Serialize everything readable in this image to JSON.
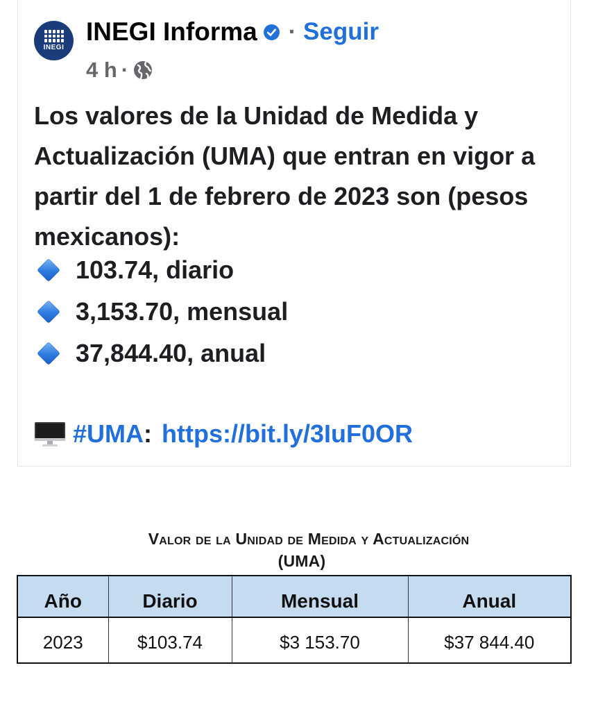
{
  "post": {
    "page_name": "INEGI Informa",
    "separator": "·",
    "follow_label": "Seguir",
    "time": "4 h",
    "meta_separator": "·",
    "avatar_text": "INEGI",
    "intro_text": "Los valores de la Unidad de Medida y Actualización (UMA) que entran en vigor a partir del 1 de febrero de 2023 son (pesos mexicanos):",
    "bullets": [
      "103.74, diario",
      "3,153.70, mensual",
      "37,844.40, anual"
    ],
    "hashtag": "#UMA",
    "colon": ":",
    "url": "https://bit.ly/3IuF0OR",
    "icons": {
      "verified": "verified-badge-icon",
      "privacy": "globe-icon",
      "bullet": "blue-diamond-icon",
      "link": "computer-icon"
    },
    "colors": {
      "link_blue": "#216fdb",
      "meta_gray": "#65676b",
      "avatar_bg": "#1b3c7a"
    }
  },
  "table": {
    "title_line1": "Valor de la Unidad de Medida y Actualización",
    "title_line2": "(UMA)",
    "headers": [
      "Año",
      "Diario",
      "Mensual",
      "Anual"
    ],
    "rows": [
      [
        "2023",
        "$103.74",
        "$3 153.70",
        "$37 844.40"
      ]
    ],
    "header_bg": "#c5dcf0"
  }
}
